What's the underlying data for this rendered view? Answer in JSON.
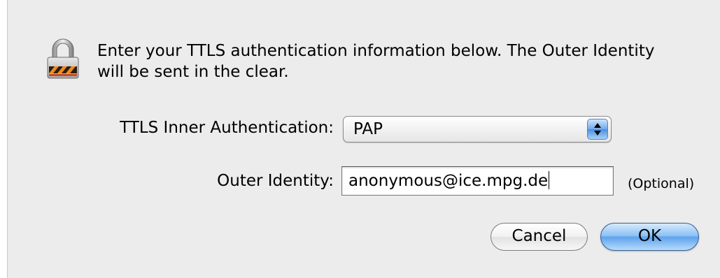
{
  "dialog": {
    "message": "Enter your TTLS authentication information below. The Outer Identity will be sent in the clear.",
    "lock_icon": "lock-icon"
  },
  "fields": {
    "inner_auth_label": "TTLS Inner Authentication:",
    "inner_auth_value": "PAP",
    "outer_identity_label": "Outer Identity:",
    "outer_identity_value": "anonymous@ice.mpg.de",
    "outer_identity_hint": "(Optional)"
  },
  "buttons": {
    "cancel": "Cancel",
    "ok": "OK"
  },
  "colors": {
    "background": "#ececec",
    "default_button": "#5fa3ee",
    "popup_arrows": "#4b8fe0"
  }
}
